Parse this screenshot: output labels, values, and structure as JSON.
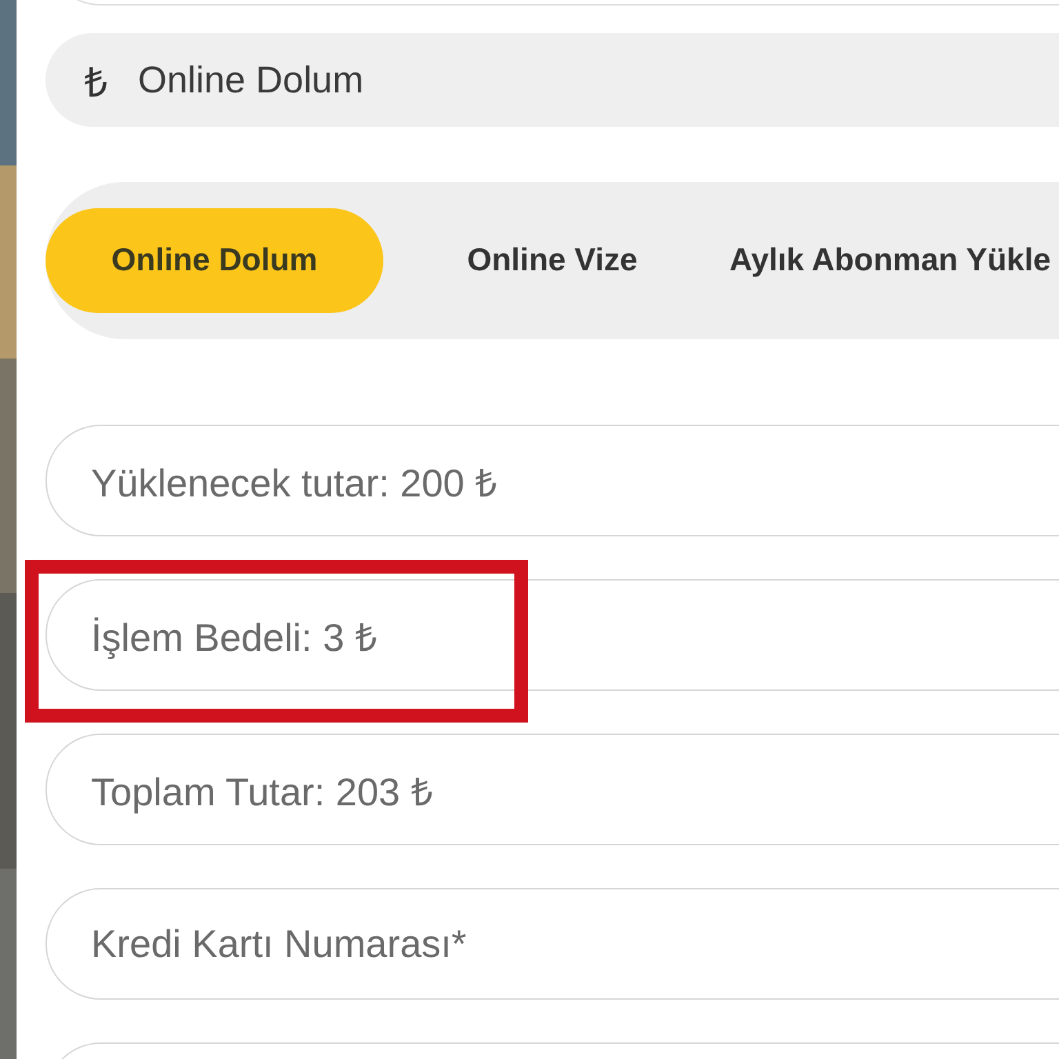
{
  "method_field": {
    "icon": "₺",
    "label": "Online Dolum"
  },
  "tabs": [
    {
      "label": "Online Dolum",
      "selected": true
    },
    {
      "label": "Online Vize",
      "selected": false
    },
    {
      "label": "Aylık Abonman Yükle",
      "selected": false
    }
  ],
  "fields": [
    {
      "value": "Yüklenecek tutar: 200 ₺",
      "highlighted": false
    },
    {
      "value": "İşlem Bedeli: 3 ₺",
      "highlighted": true
    },
    {
      "value": "Toplam Tutar: 203 ₺",
      "highlighted": false
    },
    {
      "placeholder": "Kredi Kartı Numarası*",
      "highlighted": false
    }
  ]
}
